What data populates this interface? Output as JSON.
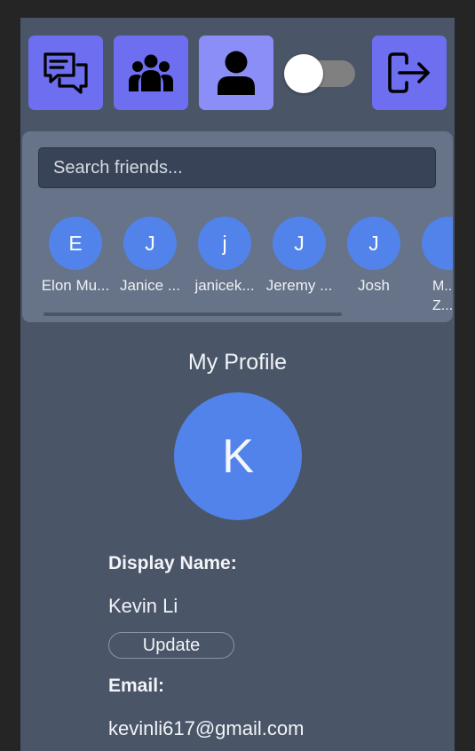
{
  "toolbar": {
    "buttons": [
      {
        "icon": "chat-icon"
      },
      {
        "icon": "users-icon"
      },
      {
        "icon": "user-icon"
      },
      {
        "icon": "logout-icon"
      }
    ],
    "theme_toggle_on": false
  },
  "search": {
    "placeholder": "Search friends...",
    "value": ""
  },
  "friends": [
    {
      "initial": "E",
      "name": "Elon Mu..."
    },
    {
      "initial": "J",
      "name": "Janice ..."
    },
    {
      "initial": "j",
      "name": "janicek..."
    },
    {
      "initial": "J",
      "name": "Jeremy ..."
    },
    {
      "initial": "J",
      "name": "Josh"
    },
    {
      "initial": "",
      "name": "M... Z..."
    }
  ],
  "profile": {
    "title": "My Profile",
    "avatar_initial": "K",
    "display_name_label": "Display Name:",
    "display_name": "Kevin Li",
    "update_label": "Update",
    "email_label": "Email:",
    "email": "kevinli617@gmail.com"
  },
  "colors": {
    "accent": "#6d6ff0",
    "accent_active": "#8c8ef7",
    "avatar": "#5283ea",
    "panel": "#4a5568"
  }
}
